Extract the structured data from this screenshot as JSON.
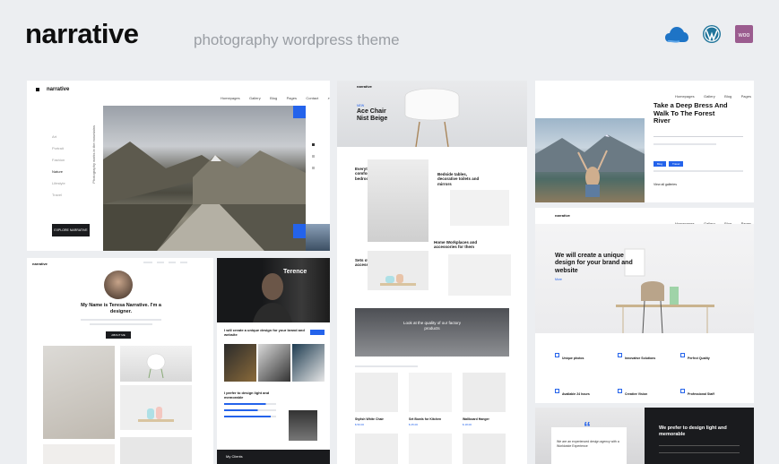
{
  "header": {
    "brand": "narrative",
    "tagline": "photography wordpress theme",
    "icons": [
      "cloud-icon",
      "wordpress-icon",
      "woo-icon"
    ],
    "colors": {
      "accent": "#2463eb",
      "woo": "#9b5c8f",
      "cloud": "#1e74c6"
    }
  },
  "cards": {
    "one": {
      "logo": "narrative",
      "nav": [
        "Homepages",
        "Gallery",
        "Blog",
        "Pages",
        "Contact"
      ],
      "side_items": [
        "Art",
        "Portrait",
        "Fashion",
        "Nature",
        "Lifestyle",
        "Travel"
      ],
      "vertical_title": "Photography works in the mountains",
      "button": "EXPLORE NARRATIVE"
    },
    "two": {
      "logo": "narrative",
      "product_title": "Ace Chair Nist Beige",
      "badge": "NEW",
      "f1": "Everything for the comfort of your bedroom",
      "f2": "Bedside tables, decorative toilets and mirrors",
      "f3": "Home Workplaces and accessories for them",
      "f4": "Sets of stylish accessories for home",
      "banner": "Look at the quality of our factory products",
      "products": [
        "Stylish White Chair",
        "Set Bowls for Kitchen",
        "Wallboard Hanger"
      ],
      "prices": [
        "$ 50.00",
        "$ 25.00",
        "$ 18.00"
      ]
    },
    "three": {
      "title": "Take a Deep Bress And Walk To The Forest River",
      "nav": [
        "Homepages",
        "Gallery",
        "Blog",
        "Pages"
      ],
      "tags": [
        "Blog",
        "Travel"
      ],
      "link": "View all galleries"
    },
    "four": {
      "logo": "narrative",
      "nav": [
        "Homepages",
        "Gallery",
        "Blog",
        "Pages",
        "Contact"
      ],
      "headline": "We will create a unique design for your brand and website",
      "more": "More",
      "features": [
        "Unique photos",
        "Innovative Solutions",
        "Perfect Quality",
        "Available 24 hours",
        "Creative Vision",
        "Professional Staff"
      ]
    },
    "five": {
      "logo": "narrative",
      "name": "My Name is Teresa Narrative. I'm a designer.",
      "button": "ABOUT ME"
    },
    "six": {
      "name": "Terence",
      "headline": "I will create a unique design for your brand and website",
      "about": "I prefer to design light and memorable",
      "footer": "My Clients"
    },
    "seven": {
      "quote": "We are an experienced design agency with a Worldwide Experience",
      "title": "We prefer to design light and memorable"
    }
  }
}
